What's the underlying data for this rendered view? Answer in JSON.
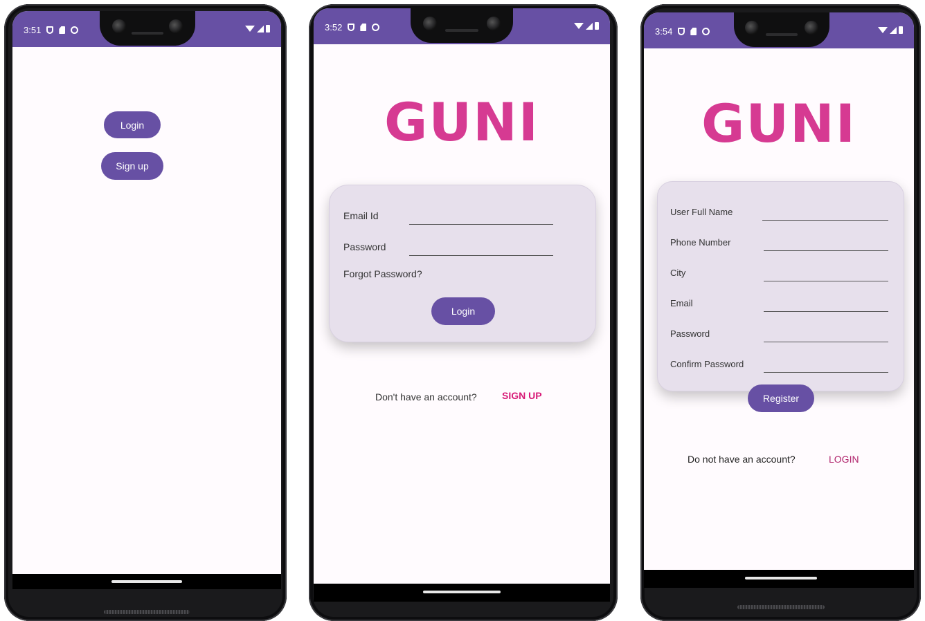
{
  "screens": [
    {
      "status": {
        "time": "3:51"
      },
      "buttons": {
        "login": "Login",
        "signup": "Sign up"
      }
    },
    {
      "status": {
        "time": "3:52"
      },
      "logo": "GUNI",
      "form": {
        "email_label": "Email Id",
        "password_label": "Password",
        "forgot_label": "Forgot Password?",
        "login_button": "Login"
      },
      "footer": {
        "prompt": "Don't have an account?",
        "link": "SIGN UP"
      }
    },
    {
      "status": {
        "time": "3:54"
      },
      "logo": "GUNI",
      "form": {
        "full_name_label": "User Full Name",
        "phone_label": "Phone Number",
        "city_label": "City",
        "email_label": "Email",
        "password_label": "Password",
        "confirm_label": "Confirm Password",
        "register_button": "Register"
      },
      "footer": {
        "prompt": "Do not have an account?",
        "link": "LOGIN"
      }
    }
  ],
  "colors": {
    "primary": "#6750a4",
    "logo": "#d63a92",
    "card": "#e7e0ec",
    "screen_bg": "#fffbfe",
    "signup_link": "#d81b78",
    "login_link": "#b0246c"
  }
}
